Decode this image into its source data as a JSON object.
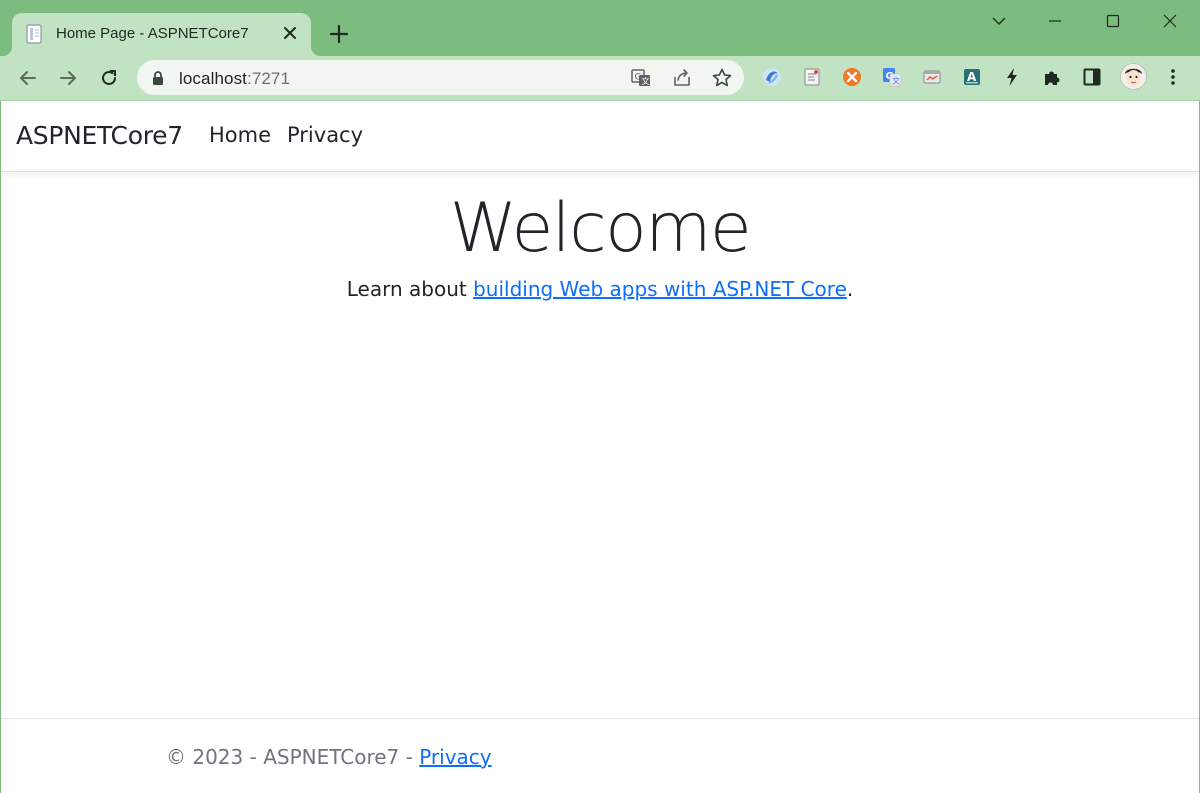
{
  "browser": {
    "tab": {
      "title": "Home Page - ASPNETCore7"
    },
    "address": {
      "host": "localhost",
      "port": ":7271"
    }
  },
  "site": {
    "brand": "ASPNETCore7",
    "nav": [
      {
        "label": "Home"
      },
      {
        "label": "Privacy"
      }
    ],
    "hero": {
      "title": "Welcome",
      "text_before": "Learn about ",
      "link_text": "building Web apps with ASP.NET Core",
      "text_after": "."
    },
    "footer": {
      "copyright": "© 2023 - ASPNETCore7 - ",
      "privacy_link": "Privacy"
    }
  },
  "colors": {
    "chrome_frame": "#7cbc7f",
    "chrome_toolbar": "#c2e3c3",
    "link": "#0d6efd",
    "text": "#212529",
    "muted": "#6c757d"
  },
  "icons": {
    "tab_favicon": "page-icon",
    "extensions": [
      "extension-blue-swirl-icon",
      "extension-note-icon",
      "extension-orange-icon",
      "google-translate-icon",
      "extension-window-icon",
      "extension-font-icon",
      "bolt-icon",
      "puzzle-icon",
      "side-panel-icon",
      "avatar"
    ]
  }
}
